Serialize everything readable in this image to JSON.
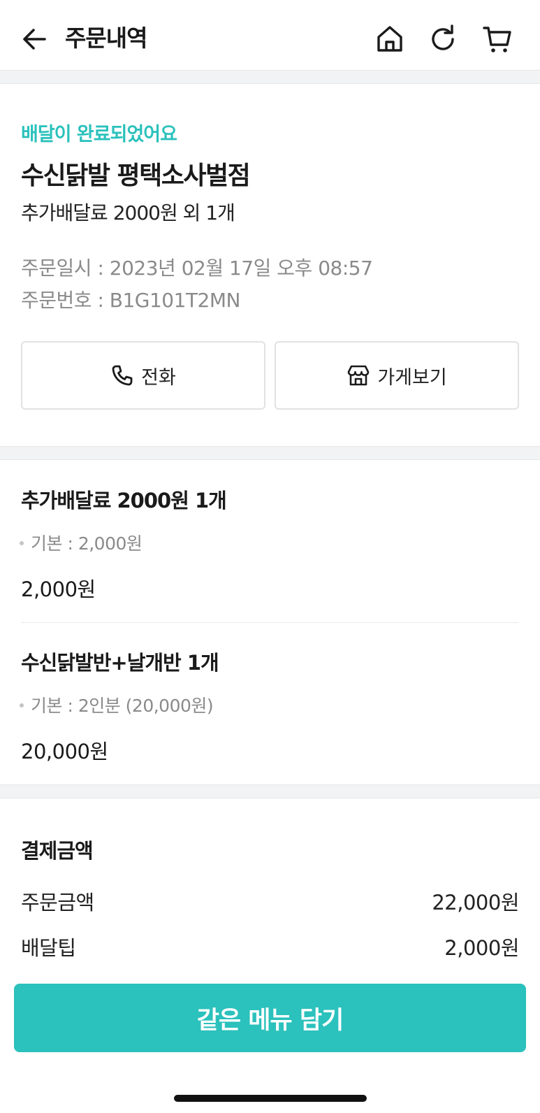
{
  "header": {
    "title": "주문내역",
    "icons": [
      "arrow-left-icon",
      "home-icon",
      "refresh-icon",
      "cart-icon"
    ]
  },
  "order": {
    "status": "배달이 완료되었어요",
    "store_name": "수신닭발 평택소사벌점",
    "summary": "추가배달료 2000원 외 1개",
    "order_datetime": "주문일시 : 2023년 02월 17일 오후 08:57",
    "order_number": "주문번호 : B1G101T2MN"
  },
  "actions": {
    "call_label": "전화",
    "store_label": "가게보기"
  },
  "items": [
    {
      "title": "추가배달료 2000원 1개",
      "option": "기본 : 2,000원",
      "price": "2,000원"
    },
    {
      "title": "수신닭발반+날개반 1개",
      "option": "기본 : 2인분 (20,000원)",
      "price": "20,000원"
    }
  ],
  "payment": {
    "title": "결제금액",
    "rows": [
      {
        "label": "주문금액",
        "value": "22,000원"
      },
      {
        "label": "배달팁",
        "value": "2,000원"
      }
    ]
  },
  "cta_label": "같은 메뉴 담기",
  "colors": {
    "accent": "#2bc1bc",
    "muted_text": "#8a8a8a",
    "separator": "#f2f3f5"
  }
}
